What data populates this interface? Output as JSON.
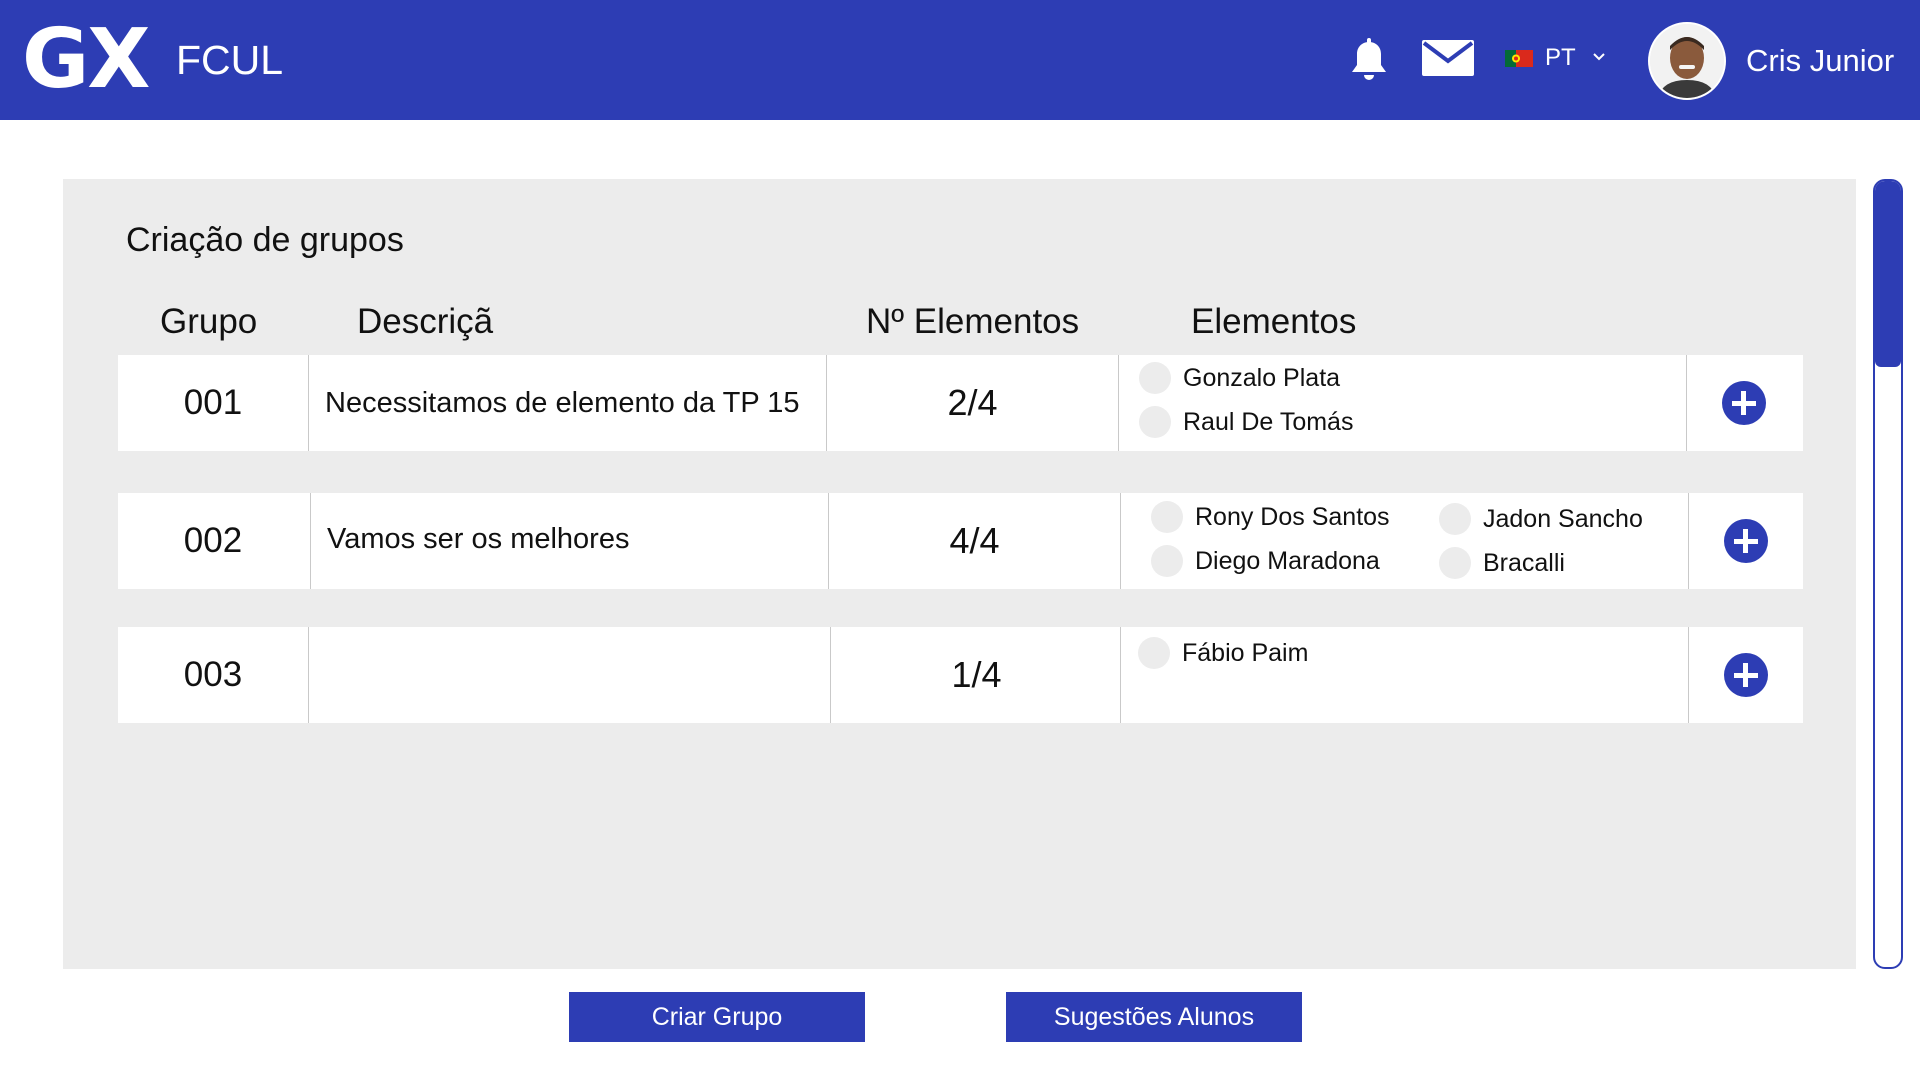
{
  "header": {
    "logo": "GX",
    "brand": "FCUL",
    "language": "PT",
    "user_name": "Cris Junior",
    "bg_color": "#2d3db4"
  },
  "panel": {
    "title": "Criação de grupos",
    "columns": {
      "grupo": "Grupo",
      "descricao": "Descriçã o",
      "num_elementos": "Nº Elementos",
      "elementos": "Elementos"
    },
    "rows": [
      {
        "grupo": "001",
        "descricao": "Necessitamos de elemento da TP 15",
        "num_elementos": "2/4",
        "members": [
          "Gonzalo Plata",
          "Raul De Tomás"
        ]
      },
      {
        "grupo": "002",
        "descricao": "Vamos ser os melhores",
        "num_elementos": "4/4",
        "members": [
          "Rony Dos Santos",
          "Jadon Sancho",
          "Diego Maradona",
          "Bracalli"
        ]
      },
      {
        "grupo": "003",
        "descricao": "",
        "num_elementos": "1/4",
        "members": [
          "Fábio Paim"
        ]
      }
    ]
  },
  "buttons": {
    "criar_grupo": "Criar Grupo",
    "sugestoes_alunos": "Sugestões Alunos"
  }
}
